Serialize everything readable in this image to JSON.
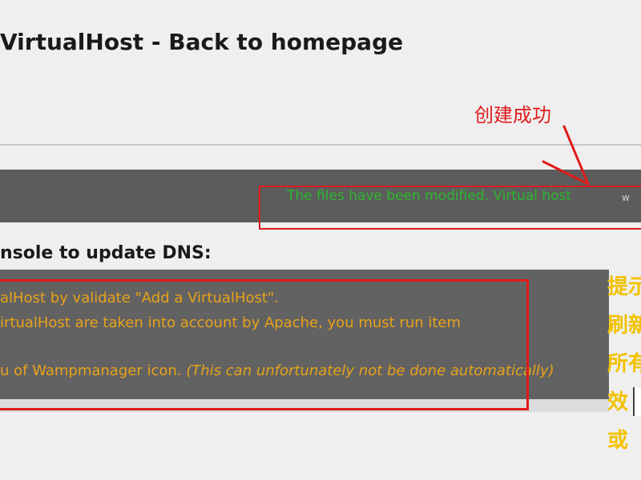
{
  "page": {
    "title": "VirtualHost - Back to homepage"
  },
  "status": {
    "message": "The files have been modified. Virtual host",
    "trailing": "w"
  },
  "annotations": {
    "success": "创建成功",
    "arrow_icon": "red-arrow-icon",
    "color_red": "#e01b1b",
    "color_hint": "#f2c200"
  },
  "section": {
    "heading": "nsole to update DNS:"
  },
  "info": {
    "line1": "alHost by validate \"Add a VirtualHost\".",
    "line2": "irtualHost are taken into account by Apache, you must run item",
    "line3_main": "u of Wampmanager icon.",
    "line3_italic": "(This can unfortunately not be done automatically)",
    "color": "#e8a21a"
  },
  "side_hints": [
    "提示",
    "刷新",
    "所有",
    "效",
    "或"
  ]
}
